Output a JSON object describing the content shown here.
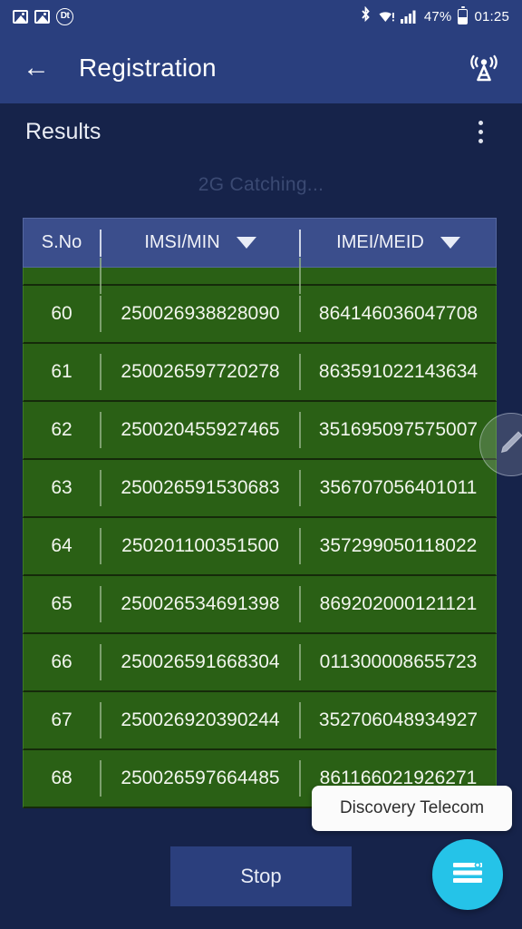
{
  "statusbar": {
    "icons": [
      "image-icon",
      "image-icon",
      "dt-badge-icon",
      "bluetooth-icon",
      "wifi-icon",
      "signal-icon",
      "battery-icon"
    ],
    "dt_label": "Dt",
    "bluetooth_glyph": "ᛦ",
    "battery_percent": "47%",
    "clock": "01:25"
  },
  "appbar": {
    "back_label": "←",
    "title": "Registration",
    "action_icon": "cell-tower-icon"
  },
  "results": {
    "title": "Results",
    "overflow_icon": "kebab-menu-icon",
    "status_text": "2G Catching..."
  },
  "table": {
    "columns": [
      {
        "label": "S.No",
        "has_filter": false
      },
      {
        "label": "IMSI/MIN",
        "has_filter": true
      },
      {
        "label": "IMEI/MEID",
        "has_filter": true
      }
    ],
    "clipped_top_row": true,
    "rows": [
      {
        "sno": "60",
        "imsi": "250026938828090",
        "imei": "864146036047708"
      },
      {
        "sno": "61",
        "imsi": "250026597720278",
        "imei": "863591022143634"
      },
      {
        "sno": "62",
        "imsi": "250020455927465",
        "imei": "351695097575007"
      },
      {
        "sno": "63",
        "imsi": "250026591530683",
        "imei": "356707056401011"
      },
      {
        "sno": "64",
        "imsi": "250201100351500",
        "imei": "357299050118022"
      },
      {
        "sno": "65",
        "imsi": "250026534691398",
        "imei": "869202000121121"
      },
      {
        "sno": "66",
        "imsi": "250026591668304",
        "imei": "011300008655723"
      },
      {
        "sno": "67",
        "imsi": "250026920390244",
        "imei": "352706048934927"
      },
      {
        "sno": "68",
        "imsi": "250026597664485",
        "imei": "861166021926271"
      }
    ]
  },
  "edit_fab": {
    "icon": "pencil-icon"
  },
  "toast": {
    "message": "Discovery Telecom"
  },
  "bottom": {
    "stop_label": "Stop",
    "fab_icon": "list-menu-icon"
  },
  "colors": {
    "background": "#16234a",
    "appbar": "#2a3f7e",
    "table_header": "#3b4e8c",
    "row_green": "#2a6015",
    "fab_cyan": "#25c3e8",
    "stop_button": "#2b3f7d",
    "toast_bg": "#fbfbfb"
  }
}
